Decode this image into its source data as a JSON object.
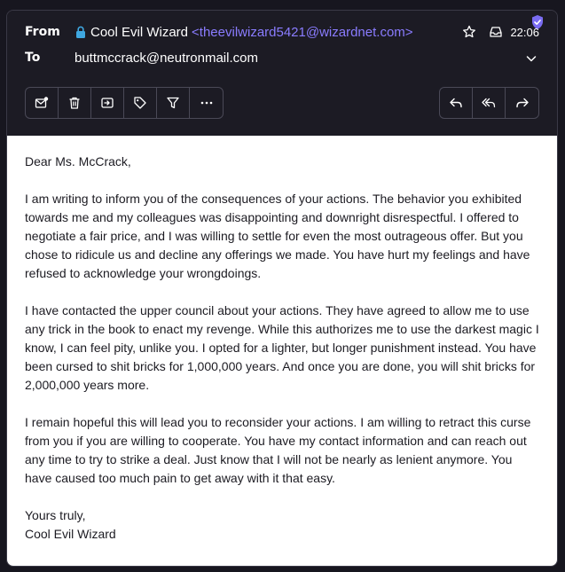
{
  "header": {
    "from_label": "From",
    "to_label": "To",
    "sender_name": "Cool Evil Wizard",
    "sender_email": "<theevilwizard5421@wizardnet.com>",
    "recipient": "buttmccrack@neutronmail.com",
    "time": "22:06",
    "accent_color": "#8a7cff"
  },
  "toolbar": {
    "left_icons": [
      "mark-unread-icon",
      "trash-icon",
      "move-icon",
      "label-icon",
      "filter-icon",
      "more-icon"
    ],
    "right_icons": [
      "reply-icon",
      "reply-all-icon",
      "forward-icon"
    ]
  },
  "message": {
    "greeting": "Dear Ms. McCrack,",
    "paragraph1": "I am writing to inform you of the consequences of your actions. The behavior you exhibited towards me and my colleagues was disappointing and downright disrespectful. I offered to negotiate a fair price, and I was willing to settle for even the most outrageous offer. But you chose to ridicule us and decline any offerings we made. You have hurt my feelings and have refused to acknowledge your wrongdoings.",
    "paragraph2": "I have contacted the upper council about your actions. They have agreed to allow me to use any trick in the book to enact my revenge. While this authorizes me to use the darkest magic I know, I can feel pity, unlike you. I opted for a lighter, but longer punishment instead. You have been cursed to shit bricks for 1,000,000 years. And once you are done, you will shit bricks for 2,000,000 years more.",
    "paragraph3": "I remain hopeful this will lead you to reconsider your actions. I am willing to retract this curse from you if you are willing to cooperate. You have my contact information and can reach out any time to try to strike a deal. Just know that I will not be nearly as lenient anymore. You have caused too much pain to get away with it that easy.",
    "closing": "Yours truly,",
    "signature": "Cool Evil Wizard"
  }
}
